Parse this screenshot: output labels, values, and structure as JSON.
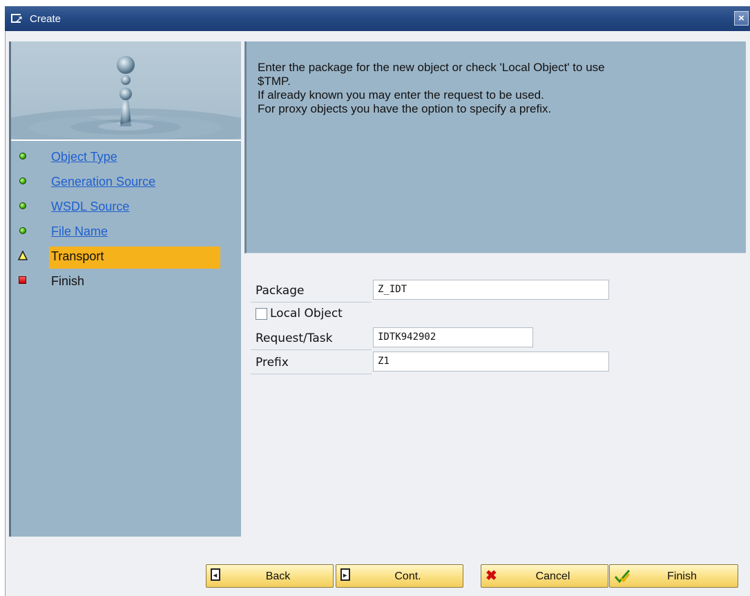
{
  "window": {
    "title": "Create",
    "title_icon": "create-icon",
    "close_glyph": "×"
  },
  "steps": [
    {
      "label": "Object Type",
      "status": "done",
      "icon": "green-led-icon"
    },
    {
      "label": "Generation Source",
      "status": "done",
      "icon": "green-led-icon"
    },
    {
      "label": "WSDL Source",
      "status": "done",
      "icon": "green-led-icon"
    },
    {
      "label": "File Name",
      "status": "done",
      "icon": "green-led-icon"
    },
    {
      "label": "Transport",
      "status": "current",
      "icon": "warning-triangle-icon"
    },
    {
      "label": "Finish",
      "status": "pending",
      "icon": "red-square-icon"
    }
  ],
  "info": {
    "lines": [
      "Enter the package for the new object or check 'Local Object' to use",
      "$TMP.",
      "If already known you may enter the request to be used.",
      "For proxy objects you have the option to specify a prefix."
    ]
  },
  "form": {
    "package_label": "Package",
    "package_value": "Z_IDT",
    "local_object_label": "Local Object",
    "local_object_checked": false,
    "request_label": "Request/Task",
    "request_value": "IDTK942902",
    "prefix_label": "Prefix",
    "prefix_value": "Z1"
  },
  "buttons": {
    "back": "Back",
    "cont": "Cont.",
    "cancel": "Cancel",
    "finish": "Finish"
  },
  "colors": {
    "titlebar": "#254a85",
    "panel": "#9bb5c8",
    "active_step": "#f6b21b",
    "link": "#1f5fcf",
    "button": "#fbe083"
  }
}
